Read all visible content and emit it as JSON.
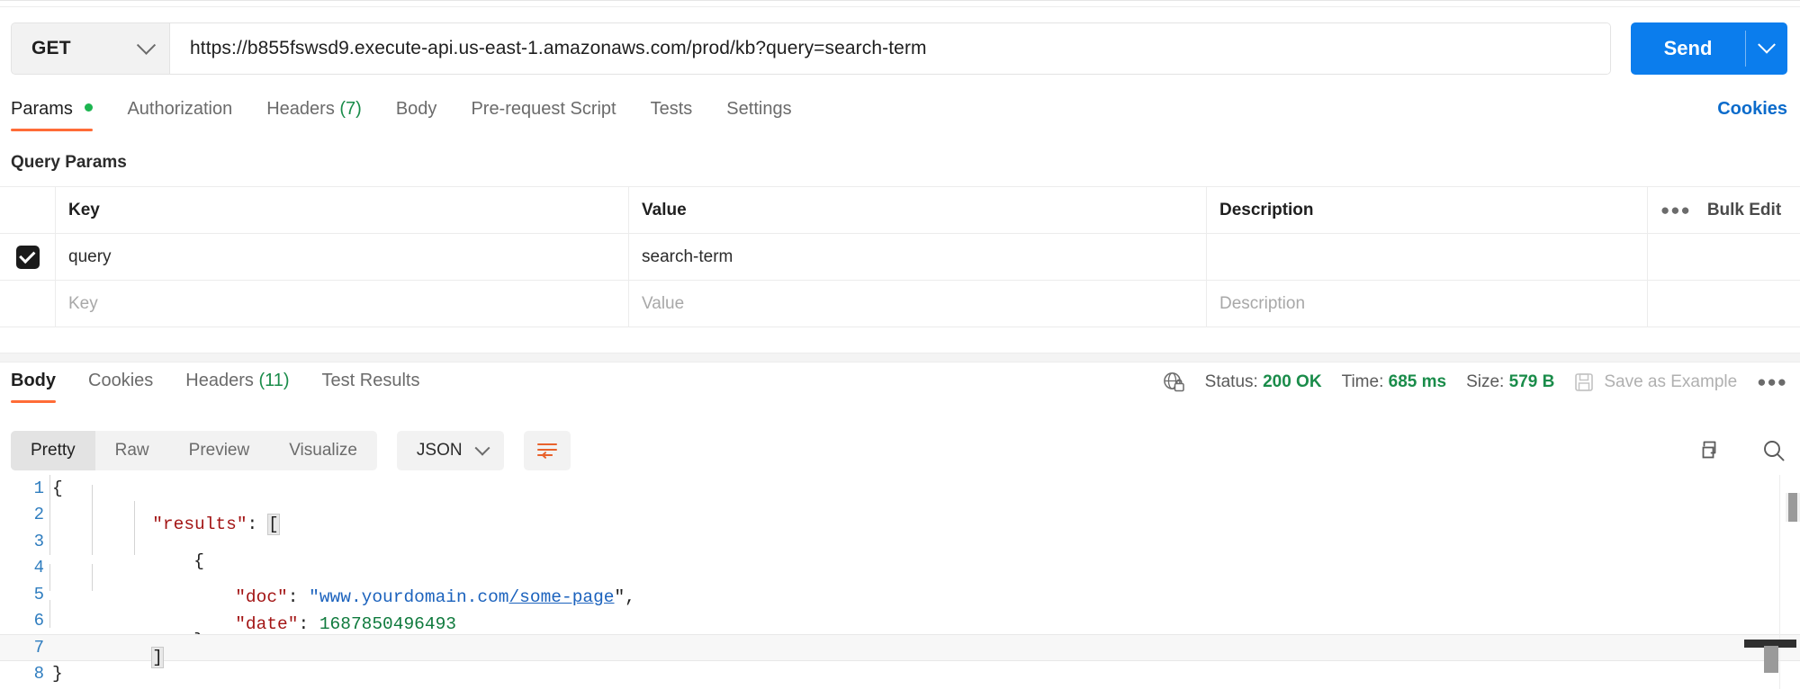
{
  "request": {
    "method": "GET",
    "url": "https://b855fswsd9.execute-api.us-east-1.amazonaws.com/prod/kb?query=search-term",
    "send_label": "Send",
    "accent_blue": "#0b7ded",
    "accent_orange": "#ff6c37"
  },
  "request_tabs": [
    {
      "label": "Params",
      "badge": "",
      "dot": true,
      "active": true
    },
    {
      "label": "Authorization",
      "badge": "",
      "dot": false,
      "active": false
    },
    {
      "label": "Headers",
      "badge": "(7)",
      "dot": false,
      "active": false
    },
    {
      "label": "Body",
      "badge": "",
      "dot": false,
      "active": false
    },
    {
      "label": "Pre-request Script",
      "badge": "",
      "dot": false,
      "active": false
    },
    {
      "label": "Tests",
      "badge": "",
      "dot": false,
      "active": false
    },
    {
      "label": "Settings",
      "badge": "",
      "dot": false,
      "active": false
    }
  ],
  "cookies_link": "Cookies",
  "query_params": {
    "section_label": "Query Params",
    "columns": [
      "Key",
      "Value",
      "Description"
    ],
    "bulk_edit_label": "Bulk Edit",
    "rows": [
      {
        "checked": true,
        "key": "query",
        "value": "search-term",
        "description": ""
      }
    ],
    "placeholder_row": {
      "key": "Key",
      "value": "Value",
      "description": "Description"
    }
  },
  "response_tabs": [
    {
      "label": "Body",
      "badge": "",
      "active": true
    },
    {
      "label": "Cookies",
      "badge": "",
      "active": false
    },
    {
      "label": "Headers",
      "badge": "(11)",
      "active": false
    },
    {
      "label": "Test Results",
      "badge": "",
      "active": false
    }
  ],
  "response_meta": {
    "status_label": "Status:",
    "status_value": "200 OK",
    "time_label": "Time:",
    "time_value": "685 ms",
    "size_label": "Size:",
    "size_value": "579 B",
    "save_as_example": "Save as Example",
    "overflow": "000"
  },
  "format_bar": {
    "views": [
      "Pretty",
      "Raw",
      "Preview",
      "Visualize"
    ],
    "active_view": "Pretty",
    "language": "JSON"
  },
  "body_code": {
    "lines": [
      {
        "n": "1",
        "active": false
      },
      {
        "n": "2",
        "active": false
      },
      {
        "n": "3",
        "active": false
      },
      {
        "n": "4",
        "active": false
      },
      {
        "n": "5",
        "active": false
      },
      {
        "n": "6",
        "active": false
      },
      {
        "n": "7",
        "active": true
      },
      {
        "n": "8",
        "active": false
      }
    ],
    "tokens": {
      "l1_open": "{",
      "l2_key": "\"results\"",
      "l2_colon": ": ",
      "l2_bracket": "[",
      "l3_open": "{",
      "l4_key": "\"doc\"",
      "l4_colon": ": ",
      "l4_val_pre": "\"www.yourdomain.com",
      "l4_val_link": "/some-page",
      "l4_val_post": "\",",
      "l5_key": "\"date\"",
      "l5_colon": ": ",
      "l5_val": "1687850496493",
      "l6_close": "}",
      "l7_bracket": "]",
      "l8_close": "}"
    }
  }
}
